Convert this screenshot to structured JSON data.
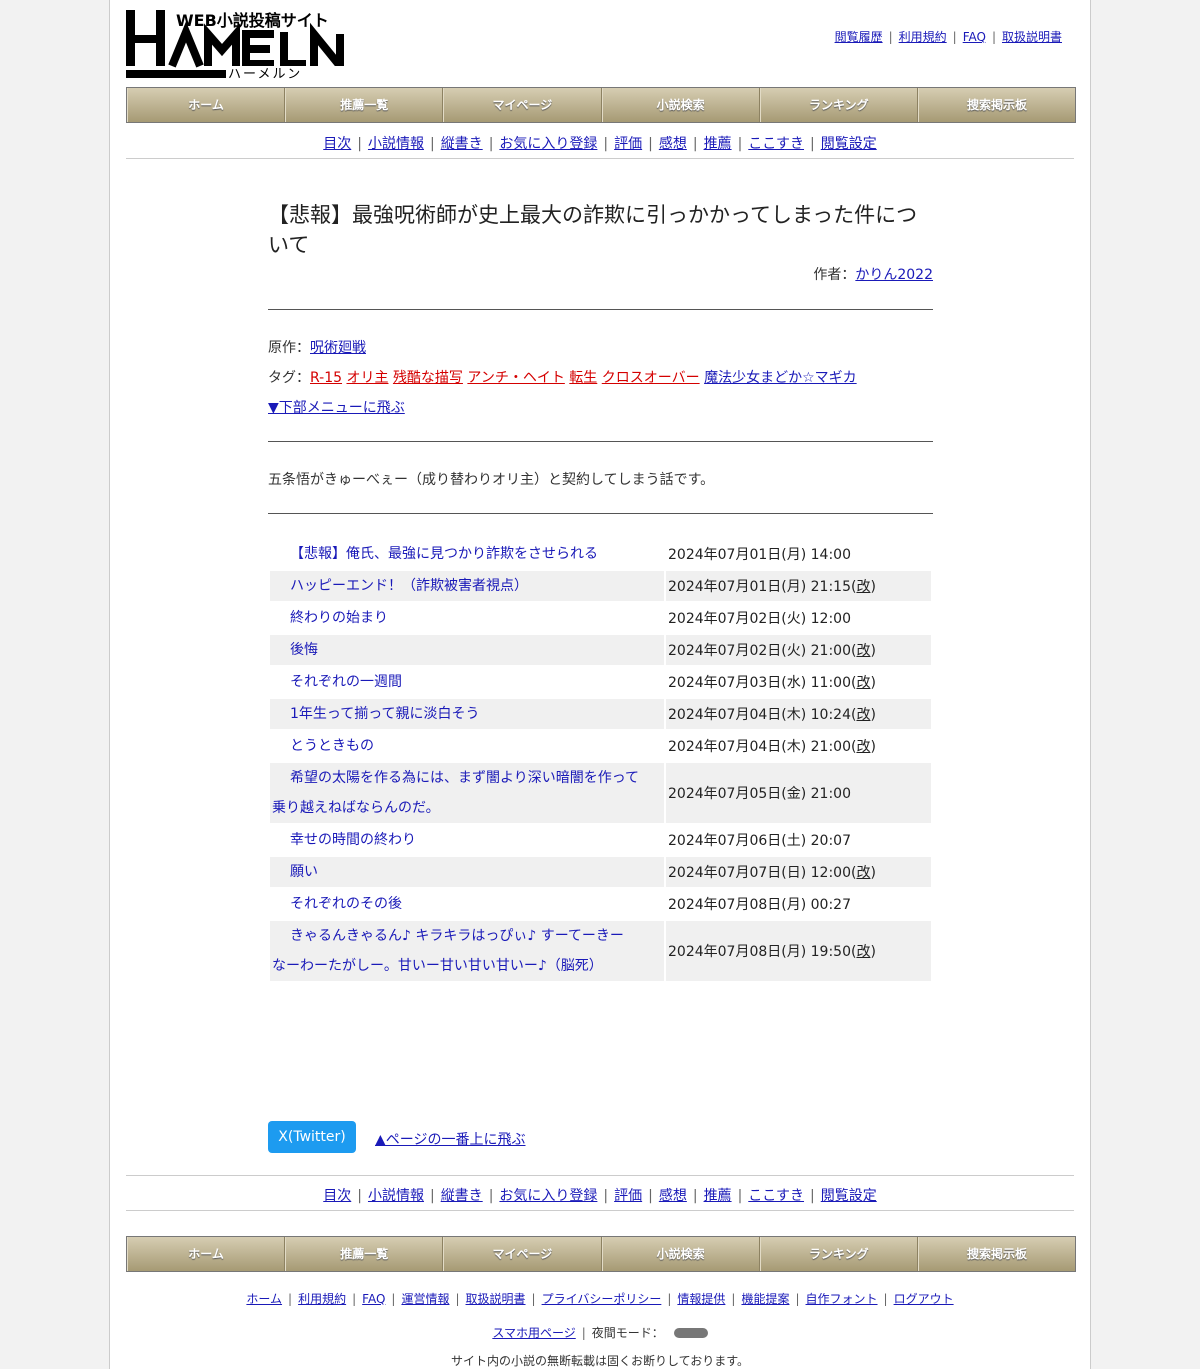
{
  "header": {
    "logo_tagline": "WEB小説投稿サイト",
    "logo_word": "HAMELN",
    "logo_kana": "ハーメルン",
    "top_links": [
      "閲覧履歴",
      "利用規約",
      "FAQ",
      "取扱説明書"
    ]
  },
  "nav": [
    "ホーム",
    "推薦一覧",
    "マイページ",
    "小説検索",
    "ランキング",
    "捜索掲示板"
  ],
  "subnav": [
    "目次",
    "小説情報",
    "縦書き",
    "お気に入り登録",
    "評価",
    "感想",
    "推薦",
    "ここすき",
    "閲覧設定"
  ],
  "novel": {
    "title": "【悲報】最強呪術師が史上最大の詐欺に引っかかってしまった件について",
    "author_label": "作者：",
    "author": "かりん2022",
    "origin_label": "原作：",
    "origin": "呪術廻戦",
    "tags_label": "タグ：",
    "tags_red": [
      "R-15",
      "オリ主",
      "残酷な描写",
      "アンチ・ヘイト",
      "転生",
      "クロスオーバー"
    ],
    "tags_blue": [
      "魔法少女まどか☆マギカ"
    ],
    "jump_bottom": "▼下部メニューに飛ぶ",
    "synopsis": "五条悟がきゅーべぇー（成り替わりオリ主）と契約してしまう話です。"
  },
  "episodes": [
    {
      "title": "【悲報】俺氏、最強に見つかり詐欺をさせられる",
      "date": "2024年07月01日(月) 14:00",
      "revised": ""
    },
    {
      "title": "ハッピーエンド！（詐欺被害者視点）",
      "date": "2024年07月01日(月) 21:15",
      "revised": "改"
    },
    {
      "title": "終わりの始まり",
      "date": "2024年07月02日(火) 12:00",
      "revised": ""
    },
    {
      "title": "後悔",
      "date": "2024年07月02日(火) 21:00",
      "revised": "改"
    },
    {
      "title": "それぞれの一週間",
      "date": "2024年07月03日(水) 11:00",
      "revised": "改"
    },
    {
      "title": "1年生って揃って親に淡白そう",
      "date": "2024年07月04日(木) 10:24",
      "revised": "改"
    },
    {
      "title": "とうときもの",
      "date": "2024年07月04日(木) 21:00",
      "revised": "改"
    },
    {
      "title_l1": "希望の太陽を作る為には、まず闇より深い暗闇を作って",
      "title_l2": "乗り越えねばならんのだ。",
      "date": "2024年07月05日(金) 21:00",
      "revised": ""
    },
    {
      "title": "幸せの時間の終わり",
      "date": "2024年07月06日(土) 20:07",
      "revised": ""
    },
    {
      "title": "願い",
      "date": "2024年07月07日(日) 12:00",
      "revised": "改"
    },
    {
      "title": "それぞれのその後",
      "date": "2024年07月08日(月) 00:27",
      "revised": ""
    },
    {
      "title_l1": "きゃるんきゃるん♪ キラキラはっぴぃ♪ すーてーきー",
      "title_l2": "なーわーたがしー。甘いー甘い甘い甘いー♪（脳死）",
      "date": "2024年07月08日(月) 19:50",
      "revised": "改"
    }
  ],
  "share": {
    "x_label": "X(Twitter)",
    "back_to_top": "▲ページの一番上に飛ぶ"
  },
  "footer": {
    "links": [
      "ホーム",
      "利用規約",
      "FAQ",
      "運営情報",
      "取扱説明書",
      "プライバシーポリシー",
      "情報提供",
      "機能提案",
      "自作フォント",
      "ログアウト"
    ],
    "mobile": "スマホ用ページ",
    "night_mode": "夜間モード：",
    "copyright": "サイト内の小説の無断転載は固くお断りしております。"
  }
}
